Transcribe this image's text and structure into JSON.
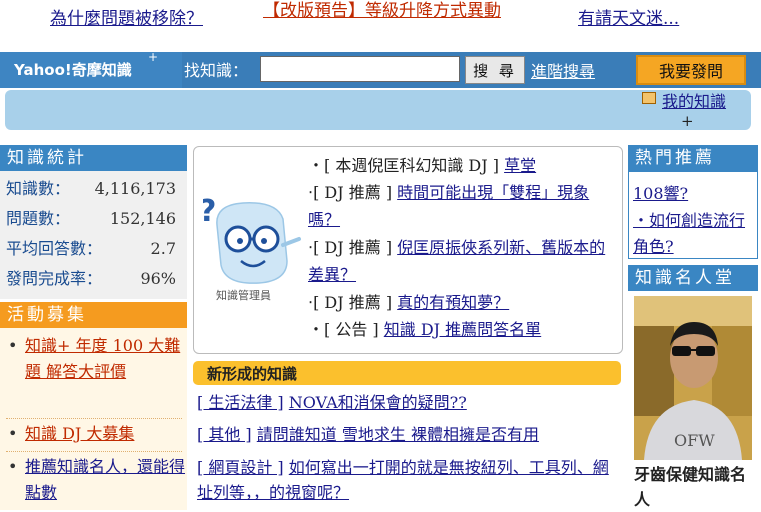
{
  "notices": {
    "left": "為什麼問題被移除？",
    "center_tag": "【改版預告】",
    "center_text": "等級升降方式異動",
    "right": "有請天文迷..."
  },
  "header": {
    "logo": "Yahoo!奇摩知識",
    "logo_plus": "+",
    "search_label": "找知識：",
    "search_value": "",
    "search_button": "搜 尋",
    "advanced_search": "進階搜尋",
    "ask_button": "我要發問",
    "my_knowledge": "我的知識",
    "plus": "+"
  },
  "stats": {
    "title": "知識統計",
    "rows": [
      {
        "label": "知識數：",
        "value": "4,116,173"
      },
      {
        "label": "問題數：",
        "value": "152,146"
      },
      {
        "label": "平均回答數：",
        "value": "2.7"
      },
      {
        "label": "發問完成率：",
        "value": "96%"
      }
    ]
  },
  "activities": {
    "title": "活動募集",
    "items": [
      {
        "text": "知識+ 年度 100 大難題 解答大評價"
      },
      {
        "text": "知識 DJ 大募集"
      },
      {
        "text": "推薦知識名人，還能得點數"
      }
    ]
  },
  "dj": {
    "mascot_label": "知識管理員",
    "lines": [
      {
        "tag": "‧[ 本週倪匡科幻知識 DJ ]",
        "link": "草堂"
      },
      {
        "tag": "‧[ DJ 推薦 ]",
        "link": "時間可能出現「雙程」現象嗎？"
      },
      {
        "tag": "‧[ DJ 推薦 ]",
        "link": "倪匡原振俠系列新、舊版本的差異？"
      },
      {
        "tag": "‧[ DJ 推薦 ]",
        "link": "真的有預知夢？"
      },
      {
        "tag": "‧[ 公告 ]",
        "link": "知識 DJ 推薦問答名單"
      }
    ]
  },
  "new_knowledge": {
    "title": "新形成的知識",
    "items": [
      {
        "category": "[ 生活法律 ]",
        "question": "NOVA和消保會的疑問??"
      },
      {
        "category": "[ 其他 ]",
        "question": "請問誰知道 雪地求生 裸體相擁是否有用"
      },
      {
        "category": "[ 網頁設計 ]",
        "question": "如何寫出一打開的就是無按紐列、工具列、網址列等，，的視窗呢？"
      }
    ]
  },
  "hot": {
    "title": "熱門推薦",
    "items": [
      {
        "text": "108響?"
      },
      {
        "text": "‧如何創造流行角色?"
      }
    ]
  },
  "fame": {
    "title": "知識名人堂",
    "name": "牙齒保健知識名人"
  }
}
